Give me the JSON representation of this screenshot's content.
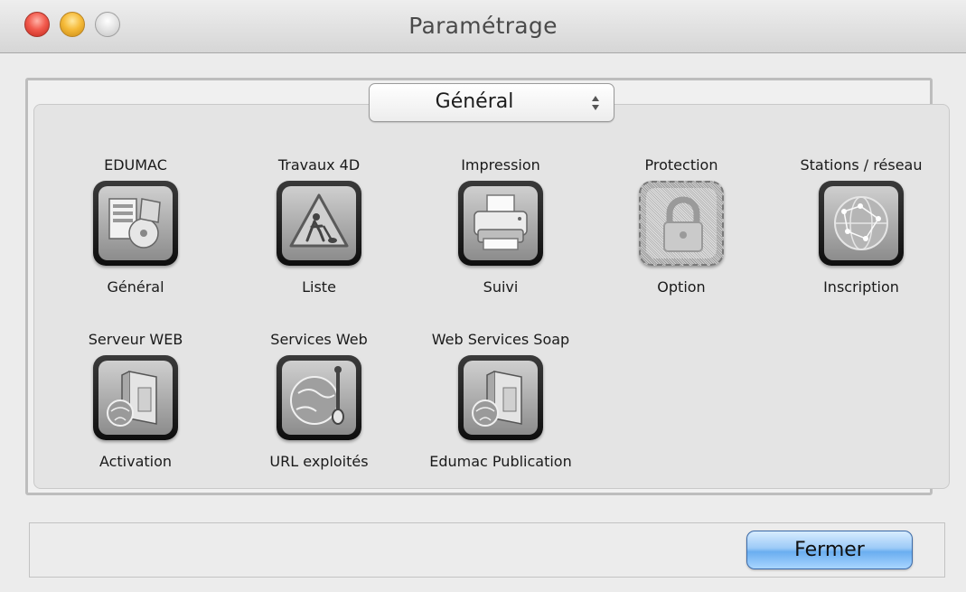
{
  "window": {
    "title": "Paramétrage"
  },
  "popup": {
    "selected": "Général"
  },
  "items": [
    {
      "top": "EDUMAC",
      "bottom": "Général",
      "icon": "installer-icon",
      "enabled": true
    },
    {
      "top": "Travaux 4D",
      "bottom": "Liste",
      "icon": "construction-sign-icon",
      "enabled": true
    },
    {
      "top": "Impression",
      "bottom": "Suivi",
      "icon": "printer-icon",
      "enabled": true
    },
    {
      "top": "Protection",
      "bottom": "Option",
      "icon": "padlock-icon",
      "enabled": false
    },
    {
      "top": "Stations / réseau",
      "bottom": "Inscription",
      "icon": "network-globe-icon",
      "enabled": true
    },
    {
      "top": "Serveur WEB",
      "bottom": "Activation",
      "icon": "web-server-icon",
      "enabled": true
    },
    {
      "top": "Services Web",
      "bottom": "URL exploités",
      "icon": "globe-tools-icon",
      "enabled": true
    },
    {
      "top": "Web Services Soap",
      "bottom": "Edumac Publication",
      "icon": "web-server-icon",
      "enabled": true
    }
  ],
  "buttons": {
    "close": "Fermer"
  },
  "colors": {
    "accent_button": "#8cc3f5",
    "window_bg": "#ececec"
  }
}
